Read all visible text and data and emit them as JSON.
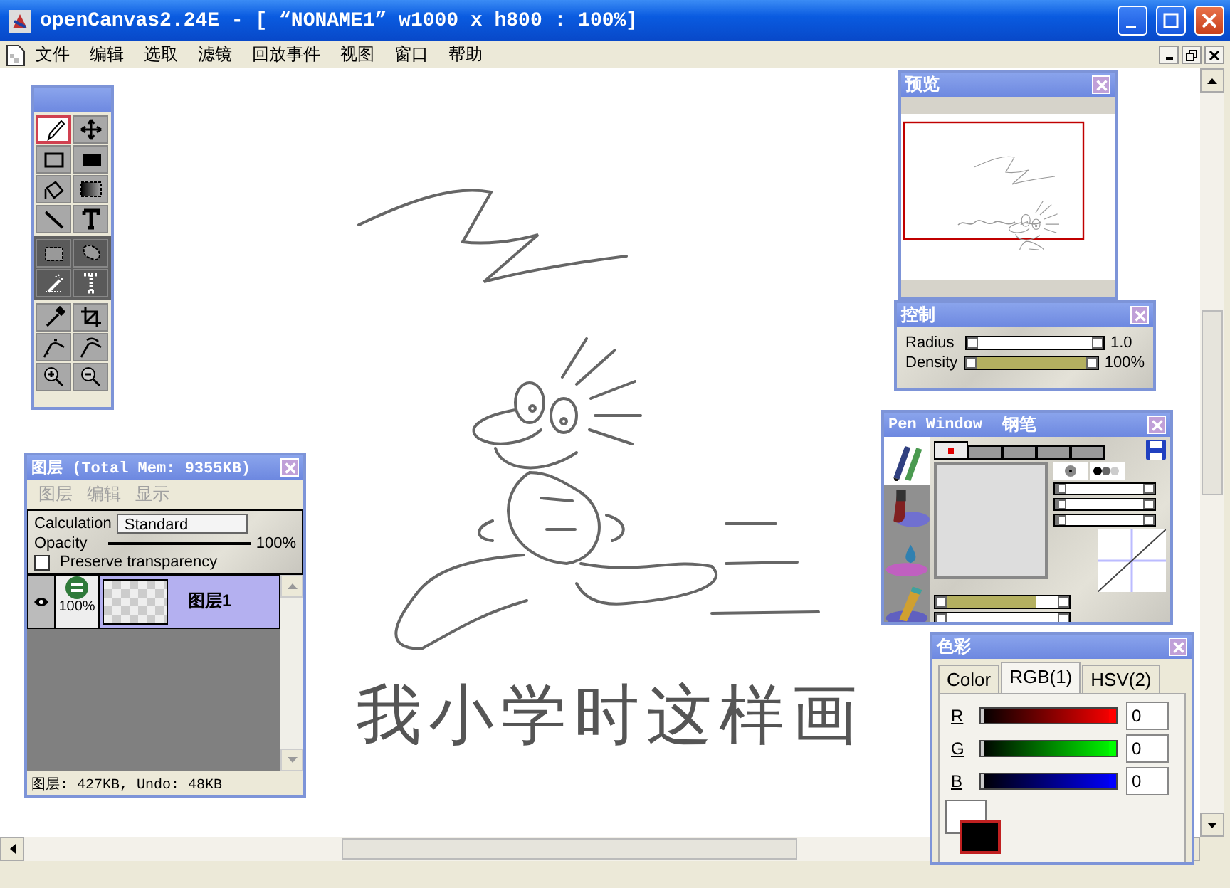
{
  "window": {
    "title": "openCanvas2.24E - [ “NONAME1” w1000 x h800 : 100%]"
  },
  "menu": [
    "文件",
    "编辑",
    "选取",
    "滤镜",
    "回放事件",
    "视图",
    "窗口",
    "帮助"
  ],
  "canvas": {
    "caption": "我小学时这样画"
  },
  "toolbox": {
    "groups": [
      [
        {
          "kind": "pen",
          "selected": true
        },
        {
          "kind": "move",
          "selected": false
        },
        {
          "kind": "rect",
          "selected": false
        },
        {
          "kind": "fill-rect",
          "selected": false
        },
        {
          "kind": "bucket",
          "selected": false
        },
        {
          "kind": "gradient",
          "selected": false
        },
        {
          "kind": "line",
          "selected": false
        },
        {
          "kind": "text",
          "selected": false
        }
      ],
      [
        {
          "kind": "select-rect",
          "selected": false
        },
        {
          "kind": "lasso",
          "selected": false
        },
        {
          "kind": "wand",
          "selected": false
        },
        {
          "kind": "text-select",
          "selected": false
        }
      ],
      [
        {
          "kind": "eyedropper",
          "selected": false
        },
        {
          "kind": "crop",
          "selected": false
        },
        {
          "kind": "curve",
          "selected": false
        },
        {
          "kind": "curve2",
          "selected": false
        },
        {
          "kind": "zoom-in",
          "selected": false
        },
        {
          "kind": "zoom-out",
          "selected": false
        }
      ]
    ]
  },
  "layers_panel": {
    "title": "图层 (Total Mem: 9355KB)",
    "menu": [
      {
        "label": "图层",
        "disabled": true
      },
      {
        "label": "编辑",
        "disabled": true
      },
      {
        "label": "显示",
        "disabled": true
      }
    ],
    "calculation_label": "Calculation",
    "calculation": "Standard",
    "opacity_label": "Opacity",
    "opacity": {
      "level": 1,
      "reading": "100%"
    },
    "preserve": {
      "label": "Preserve transparency",
      "checked": false
    },
    "layers": [
      {
        "name": "图层1",
        "opacity": "100%",
        "visible": true,
        "selected": true
      }
    ],
    "status": "图层: 427KB, Undo: 48KB"
  },
  "preview": {
    "title": "预览"
  },
  "control": {
    "title": "控制",
    "sliders": [
      {
        "name": "Radius",
        "level": 0.03,
        "reading": "1.0"
      },
      {
        "name": "Density",
        "level": 0.97,
        "reading": "100%"
      }
    ]
  },
  "pen_window": {
    "title": "Pen Window",
    "brush": "钢笔",
    "brushes": [
      {
        "kind": "pen",
        "selected": true
      },
      {
        "kind": "brush",
        "selected": false
      },
      {
        "kind": "water",
        "selected": false
      },
      {
        "kind": "pencil",
        "selected": false
      }
    ],
    "tabs": [
      {
        "selected": true
      },
      {
        "selected": false
      },
      {
        "selected": false
      },
      {
        "selected": false
      },
      {
        "selected": false
      }
    ],
    "tip_sliders": [
      {
        "level": 0
      },
      {
        "level": 0
      },
      {
        "level": 0
      }
    ],
    "sliders": [
      {
        "level": 0.75
      },
      {
        "level": 0.04
      }
    ]
  },
  "color_panel": {
    "title": "色彩",
    "tabs": [
      {
        "label": "Color",
        "selected": false
      },
      {
        "label": "RGB(1)",
        "selected": true
      },
      {
        "label": "HSV(2)",
        "selected": false
      }
    ],
    "channels": [
      {
        "name": "R",
        "color": "#ff0000",
        "level": 0,
        "value": "0"
      },
      {
        "name": "G",
        "color": "#00ff00",
        "level": 0,
        "value": "0"
      },
      {
        "name": "B",
        "color": "#0000ff",
        "level": 0,
        "value": "0"
      }
    ],
    "swatches": [
      {
        "color": "#ffffff",
        "selected": false
      },
      {
        "color": "#000000",
        "selected": true
      }
    ]
  }
}
